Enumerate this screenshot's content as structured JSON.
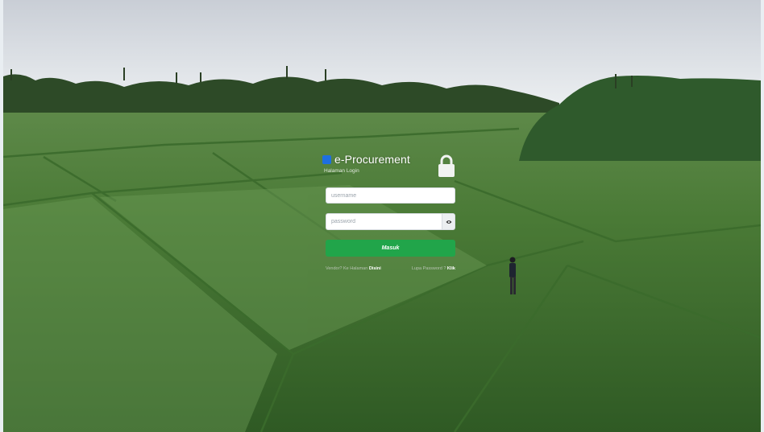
{
  "brand": {
    "title": "e-Procurement",
    "subtitle": "Halaman Login",
    "accent_color": "#1e6fe0"
  },
  "form": {
    "username_placeholder": "username",
    "password_placeholder": "password",
    "toggle_icon": "eye-icon",
    "submit_label": "Masuk",
    "submit_color": "#21a54a"
  },
  "links": {
    "register_text": "Vendor? Ke Halaman",
    "register_link": "Disini",
    "forgot_text": "Lupa Password ?",
    "forgot_link": "Klik"
  },
  "icons": {
    "lock": "lock-icon"
  }
}
